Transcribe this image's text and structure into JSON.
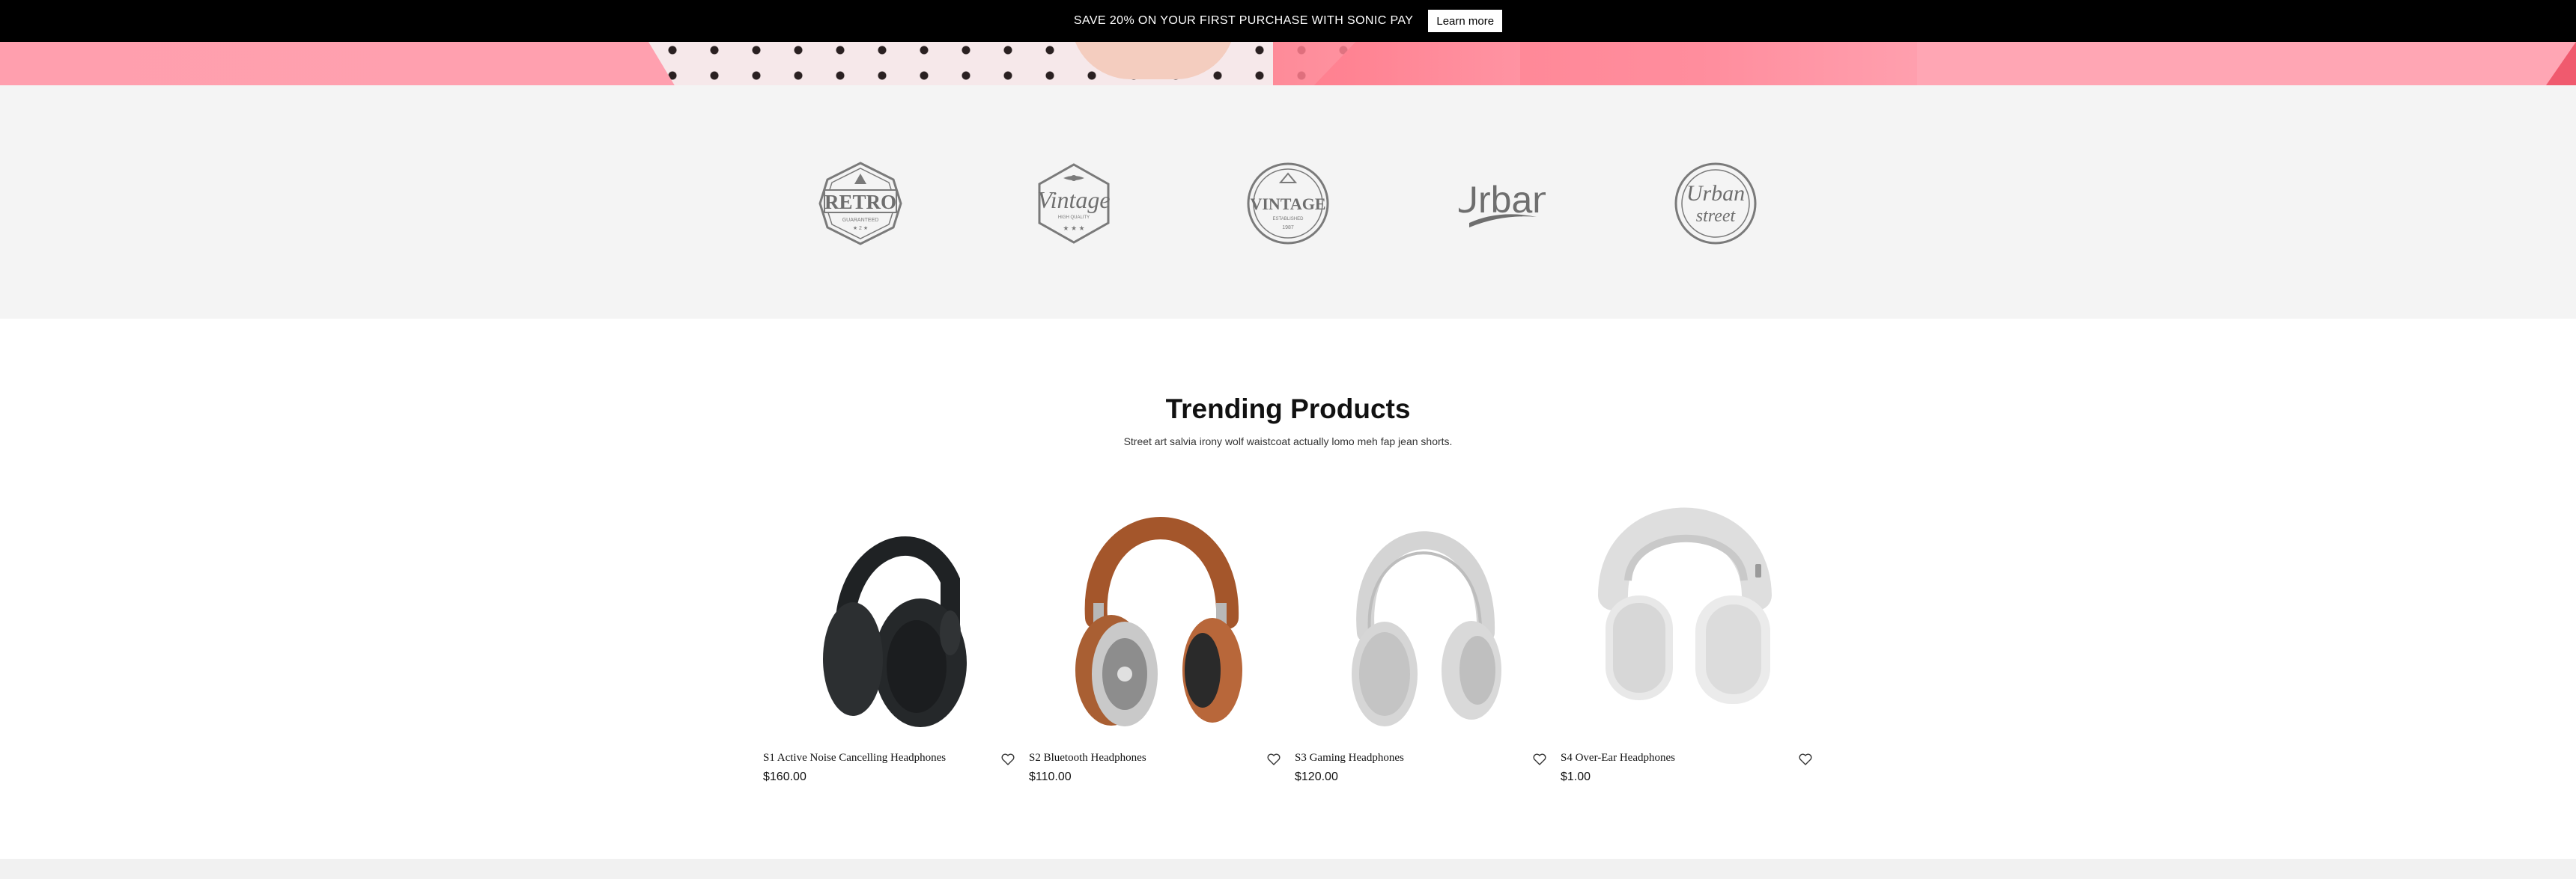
{
  "announcement": {
    "text": "SAVE 20% ON YOUR FIRST PURCHASE WITH SONIC PAY",
    "button_label": "Learn more"
  },
  "brand_logos": [
    {
      "name": "Retro",
      "icon": "retro-badge-logo"
    },
    {
      "name": "Vintage",
      "icon": "vintage-badge-logo"
    },
    {
      "name": "Vintage",
      "icon": "vintage-seal-logo"
    },
    {
      "name": "Urban",
      "icon": "urban-wordmark-logo"
    },
    {
      "name": "Urban street",
      "icon": "urban-street-seal-logo"
    }
  ],
  "trending": {
    "title": "Trending Products",
    "subtitle": "Street art salvia irony wolf waistcoat actually lomo meh fap jean shorts.",
    "products": [
      {
        "name": "S1 Active Noise Cancelling Headphones",
        "price": "$160.00",
        "color": "#26292b",
        "icon": "headphones-black"
      },
      {
        "name": "S2 Bluetooth Headphones",
        "price": "$110.00",
        "color": "#a65a2e",
        "icon": "headphones-tan-leather"
      },
      {
        "name": "S3 Gaming Headphones",
        "price": "$120.00",
        "color": "#d9d9d9",
        "icon": "headphones-silver"
      },
      {
        "name": "S4 Over-Ear Headphones",
        "price": "$1.00",
        "color": "#e6e6e6",
        "icon": "headphones-white"
      }
    ]
  },
  "colors": {
    "announcement_bg": "#000000",
    "hero_pink": "#ff9fae",
    "logos_bg": "#f4f4f4"
  }
}
